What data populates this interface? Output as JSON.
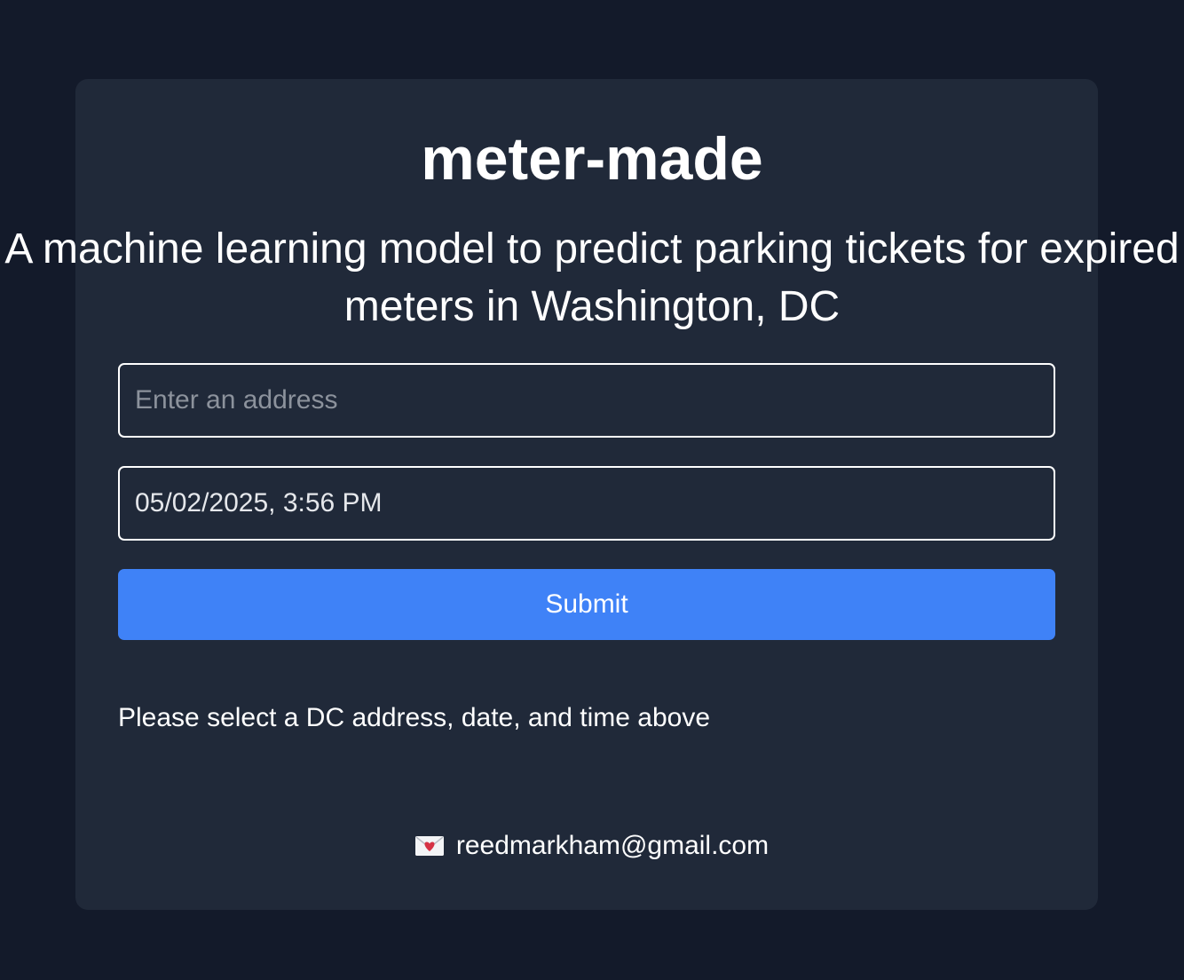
{
  "header": {
    "title": "meter-made",
    "subtitle": "A machine learning model to predict parking tickets for expired meters in Washington, DC"
  },
  "form": {
    "address_placeholder": "Enter an address",
    "address_value": "",
    "datetime_value": "05/02/2025, 3:56 PM",
    "submit_label": "Submit"
  },
  "status": {
    "message": "Please select a DC address, date, and time above"
  },
  "footer": {
    "icon": "love-letter-icon",
    "email": "reedmarkham@gmail.com"
  },
  "colors": {
    "page_background": "#131a2a",
    "card_background": "#202939",
    "accent": "#3f82f7",
    "text": "#ffffff"
  }
}
